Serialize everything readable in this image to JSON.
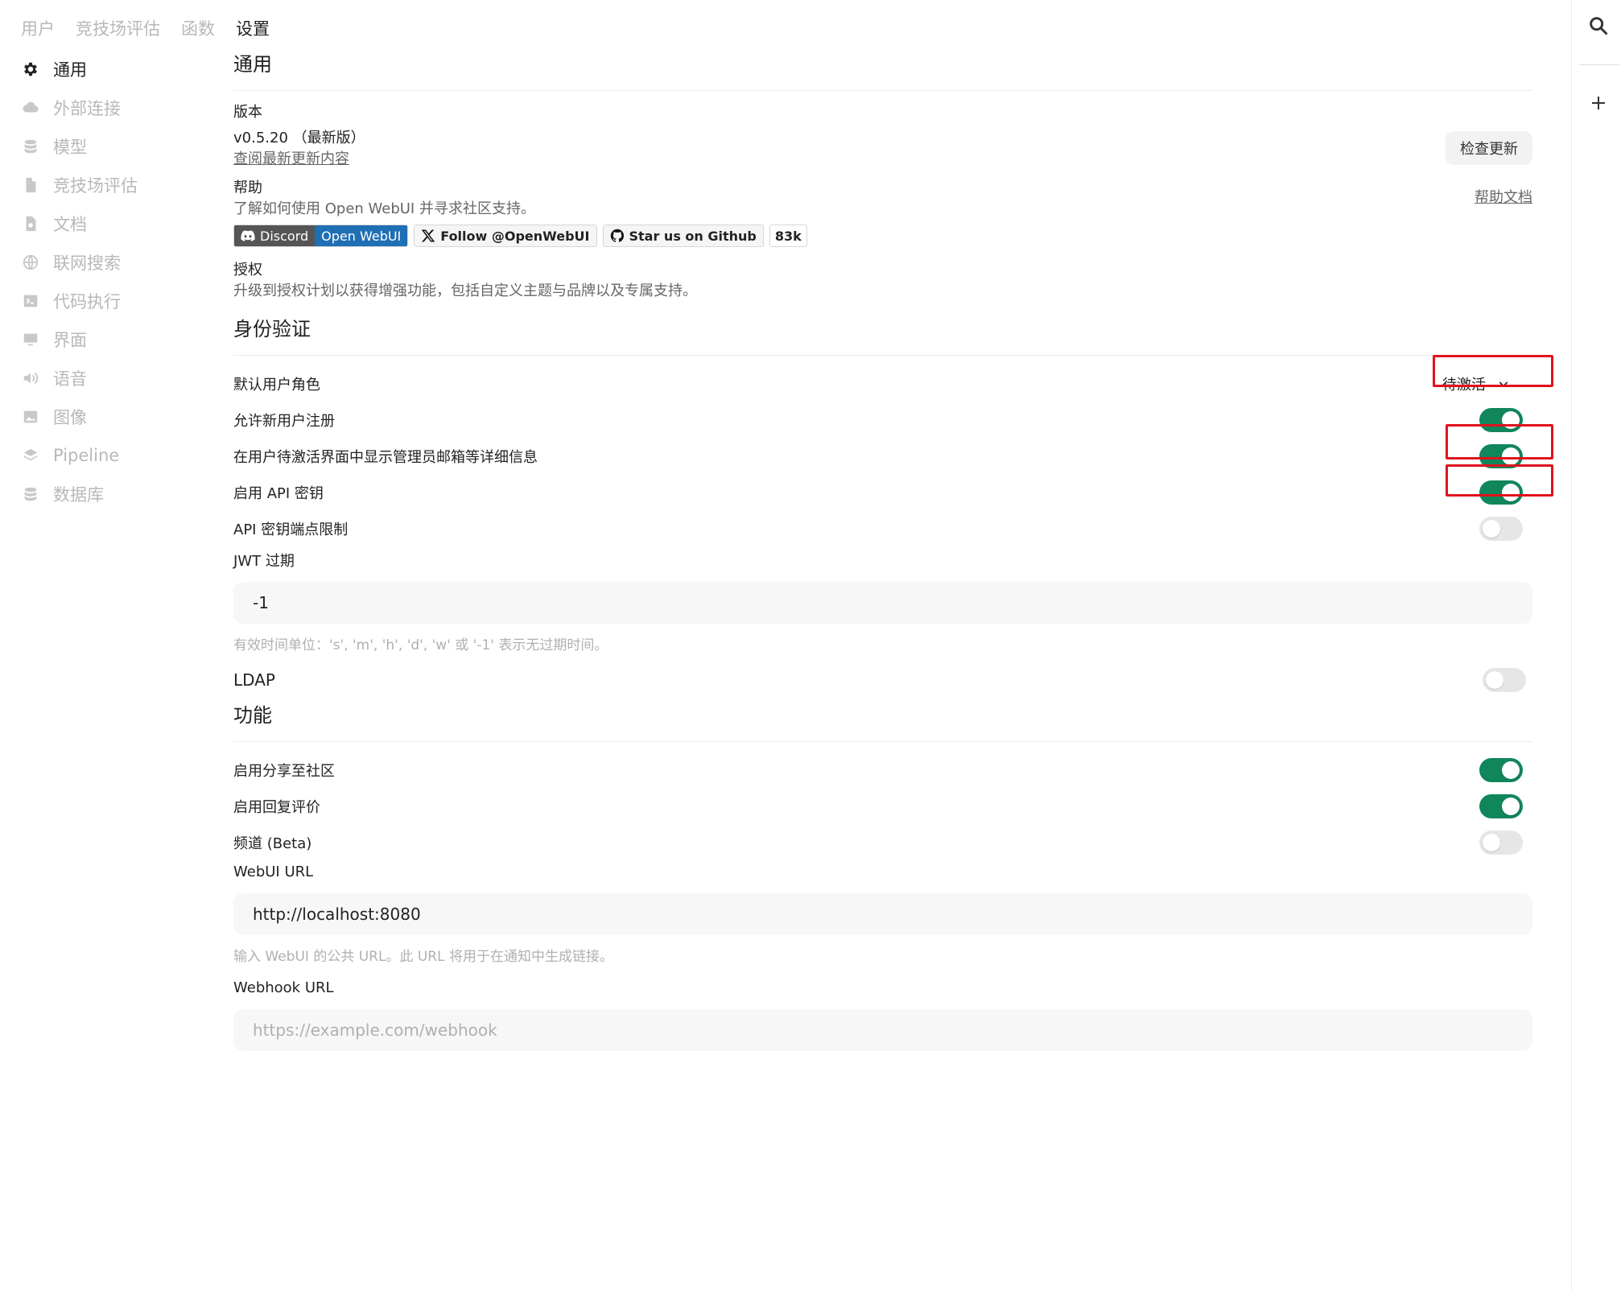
{
  "top_tabs": [
    {
      "label": "用户"
    },
    {
      "label": "竞技场评估"
    },
    {
      "label": "函数"
    },
    {
      "label": "设置"
    }
  ],
  "sidebar": {
    "items": [
      {
        "label": "通用",
        "icon": "gear-icon"
      },
      {
        "label": "外部连接",
        "icon": "cloud-icon"
      },
      {
        "label": "模型",
        "icon": "database-icon"
      },
      {
        "label": "竞技场评估",
        "icon": "document-icon"
      },
      {
        "label": "文档",
        "icon": "document-search-icon"
      },
      {
        "label": "联网搜索",
        "icon": "globe-icon"
      },
      {
        "label": "代码执行",
        "icon": "terminal-icon"
      },
      {
        "label": "界面",
        "icon": "monitor-icon"
      },
      {
        "label": "语音",
        "icon": "speaker-icon"
      },
      {
        "label": "图像",
        "icon": "image-icon"
      },
      {
        "label": "Pipeline",
        "icon": "layers-icon"
      },
      {
        "label": "数据库",
        "icon": "database-icon"
      }
    ]
  },
  "general": {
    "title": "通用",
    "version_label": "版本",
    "version_value": "v0.5.20 （最新版）",
    "changelog_link": "查阅最新更新内容",
    "check_update_button": "检查更新",
    "help_label": "帮助",
    "help_desc": "了解如何使用 Open WebUI 并寻求社区支持。",
    "help_docs_link": "帮助文档",
    "badges": {
      "discord_left": "Discord",
      "discord_right": "Open WebUI",
      "x_follow": "Follow @OpenWebUI",
      "github_star": "Star us on Github",
      "github_count": "83k"
    },
    "license_label": "授权",
    "license_desc": "升级到授权计划以获得增强功能，包括自定义主题与品牌以及专属支持。"
  },
  "auth": {
    "title": "身份验证",
    "default_role_label": "默认用户角色",
    "default_role_value": "待激活",
    "allow_signup_label": "允许新用户注册",
    "allow_signup": true,
    "show_admin_details_label": "在用户待激活界面中显示管理员邮箱等详细信息",
    "show_admin_details": true,
    "enable_api_key_label": "启用 API 密钥",
    "enable_api_key": true,
    "api_key_endpoint_label": "API 密钥端点限制",
    "api_key_endpoint": false,
    "jwt_label": "JWT 过期",
    "jwt_value": "-1",
    "jwt_hint": "有效时间单位：'s', 'm', 'h', 'd', 'w' 或 '-1' 表示无过期时间。",
    "ldap_label": "LDAP",
    "ldap": false
  },
  "features": {
    "title": "功能",
    "community_share_label": "启用分享至社区",
    "community_share": true,
    "message_rating_label": "启用回复评价",
    "message_rating": true,
    "channels_label": "频道 (Beta)",
    "channels": false,
    "webui_url_label": "WebUI URL",
    "webui_url_value": "http://localhost:8080",
    "webui_url_hint": "输入 WebUI 的公共 URL。此 URL 将用于在通知中生成链接。",
    "webhook_label": "Webhook URL",
    "webhook_placeholder": "https://example.com/webhook"
  },
  "colors": {
    "toggle_on": "#10865b",
    "toggle_off": "#e6e6e6",
    "highlight_outline": "#e0121d"
  }
}
